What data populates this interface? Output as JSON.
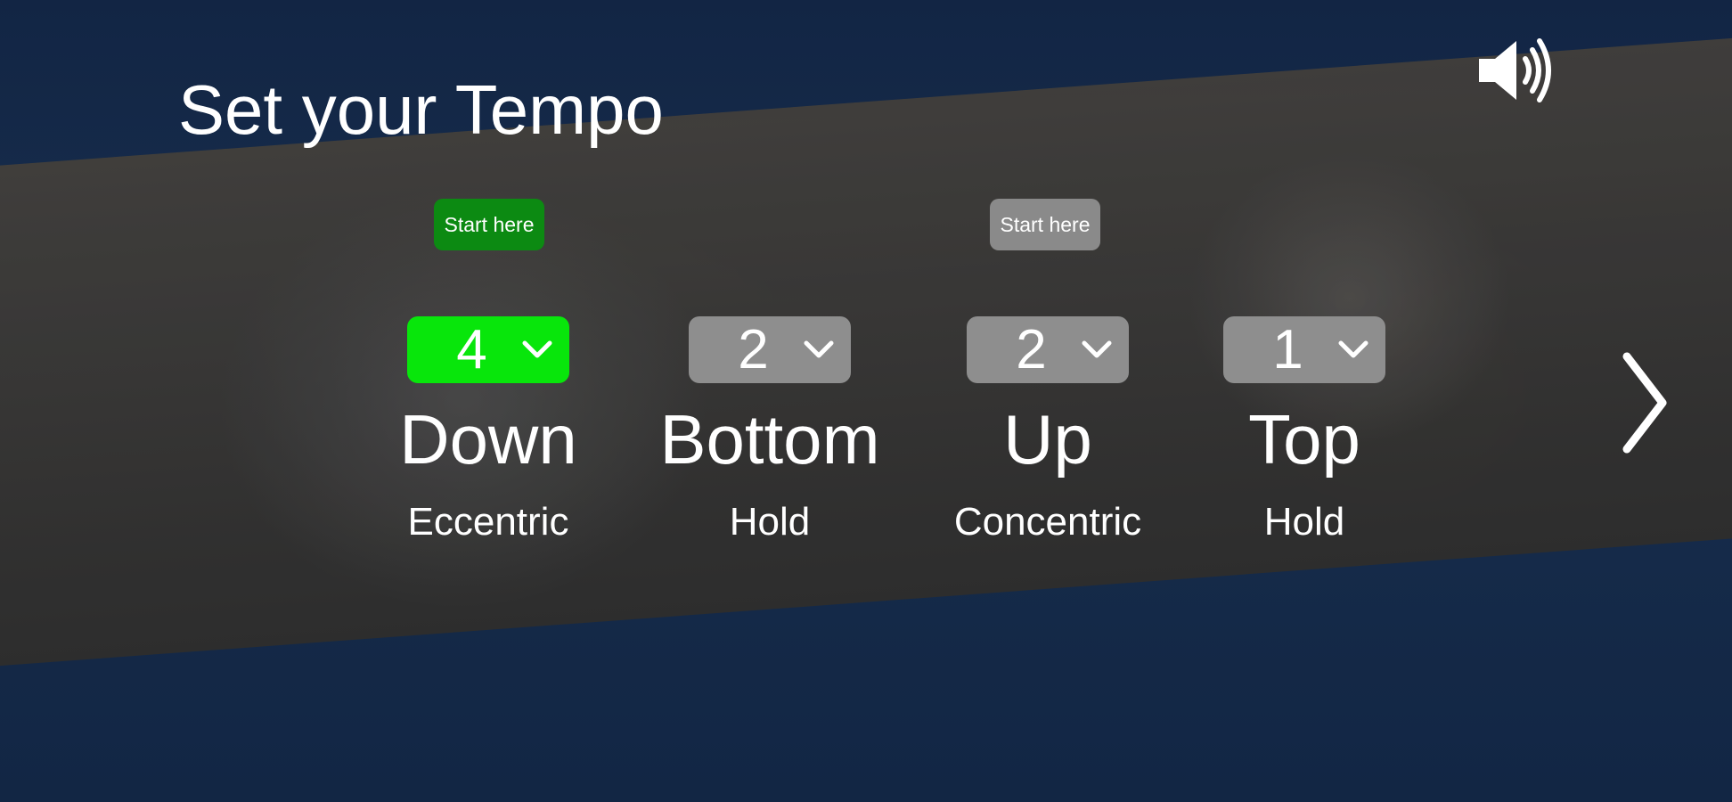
{
  "header": {
    "title": "Set your Tempo",
    "sound_icon": "speaker-volume-icon"
  },
  "start_hints": [
    {
      "label": "Start here",
      "state": "active",
      "color": "#0c8a12"
    },
    {
      "label": "Start here",
      "state": "inactive",
      "color": "#8a8a8a"
    }
  ],
  "phases": [
    {
      "value": "4",
      "name": "Down",
      "sub": "Eccentric",
      "selected": true
    },
    {
      "value": "2",
      "name": "Bottom",
      "sub": "Hold",
      "selected": false
    },
    {
      "value": "2",
      "name": "Up",
      "sub": "Concentric",
      "selected": false
    },
    {
      "value": "1",
      "name": "Top",
      "sub": "Hold",
      "selected": false
    }
  ],
  "colors": {
    "active_select": "#08e60b",
    "inactive_select": "#8e8e8e",
    "navy": "#1a3256"
  },
  "nav": {
    "next_icon": "chevron-right-icon"
  }
}
